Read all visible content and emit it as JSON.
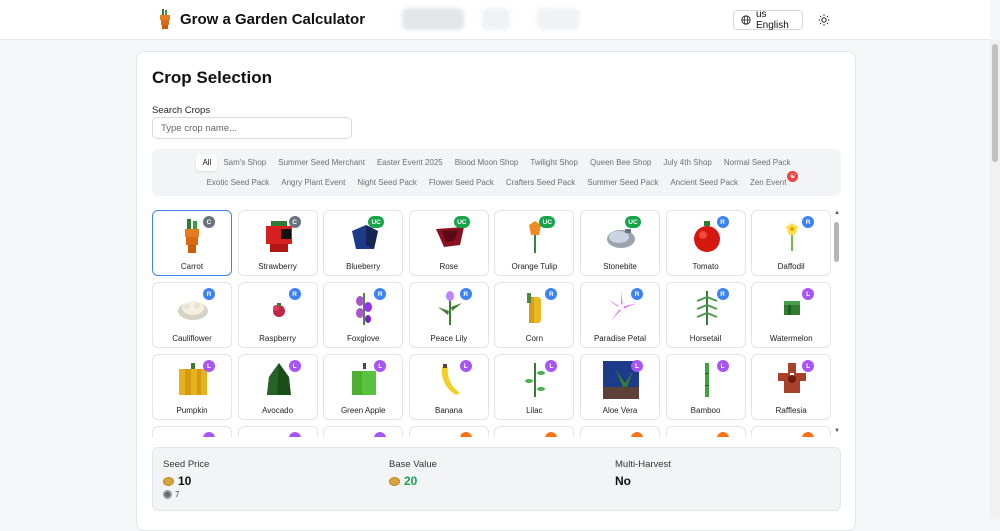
{
  "header": {
    "app_title": "Grow a Garden Calculator",
    "language_label": "us English"
  },
  "crop_selection": {
    "title": "Crop Selection",
    "search_label": "Search Crops",
    "search_placeholder": "Type crop name...",
    "filters_row1": [
      "All",
      "Sam's Shop",
      "Summer Seed Merchant",
      "Easter Event 2025",
      "Blood Moon Shop",
      "Twilight Shop",
      "Queen Bee Shop",
      "July 4th Shop",
      "Normal Seed Pack"
    ],
    "filters_row2": [
      "Exotic Seed Pack",
      "Angry Plant Event",
      "Night Seed Pack",
      "Flower Seed Pack",
      "Crafters Seed Pack",
      "Summer Seed Pack",
      "Ancient Seed Pack",
      "Zen Event"
    ],
    "active_filter": "All",
    "crops": [
      {
        "name": "Carrot",
        "rarity": "C",
        "icon": "carrot-icon"
      },
      {
        "name": "Strawberry",
        "rarity": "C",
        "icon": "strawberry-icon"
      },
      {
        "name": "Blueberry",
        "rarity": "UC",
        "icon": "blueberry-icon"
      },
      {
        "name": "Rose",
        "rarity": "UC",
        "icon": "rose-icon"
      },
      {
        "name": "Orange Tulip",
        "rarity": "UC",
        "icon": "orange-tulip-icon"
      },
      {
        "name": "Stonebite",
        "rarity": "UC",
        "icon": "stonebite-icon"
      },
      {
        "name": "Tomato",
        "rarity": "R",
        "icon": "tomato-icon"
      },
      {
        "name": "Daffodil",
        "rarity": "R",
        "icon": "daffodil-icon"
      },
      {
        "name": "Cauliflower",
        "rarity": "R",
        "icon": "cauliflower-icon"
      },
      {
        "name": "Raspberry",
        "rarity": "R",
        "icon": "raspberry-icon"
      },
      {
        "name": "Foxglove",
        "rarity": "R",
        "icon": "foxglove-icon"
      },
      {
        "name": "Peace Lily",
        "rarity": "R",
        "icon": "peace-lily-icon"
      },
      {
        "name": "Corn",
        "rarity": "R",
        "icon": "corn-icon"
      },
      {
        "name": "Paradise Petal",
        "rarity": "R",
        "icon": "paradise-petal-icon"
      },
      {
        "name": "Horsetail",
        "rarity": "R",
        "icon": "horsetail-icon"
      },
      {
        "name": "Watermelon",
        "rarity": "L",
        "icon": "watermelon-icon"
      },
      {
        "name": "Pumpkin",
        "rarity": "L",
        "icon": "pumpkin-icon"
      },
      {
        "name": "Avocado",
        "rarity": "L",
        "icon": "avocado-icon"
      },
      {
        "name": "Green Apple",
        "rarity": "L",
        "icon": "green-apple-icon"
      },
      {
        "name": "Banana",
        "rarity": "L",
        "icon": "banana-icon"
      },
      {
        "name": "Lilac",
        "rarity": "L",
        "icon": "lilac-icon"
      },
      {
        "name": "Aloe Vera",
        "rarity": "L",
        "icon": "aloe-vera-icon"
      },
      {
        "name": "Bamboo",
        "rarity": "L",
        "icon": "bamboo-icon"
      },
      {
        "name": "Rafflesia",
        "rarity": "L",
        "icon": "rafflesia-icon"
      }
    ],
    "next_row_rarities": [
      "L",
      "L",
      "L",
      "M",
      "M",
      "M",
      "M",
      "M"
    ],
    "selected_crop": "Carrot"
  },
  "stats": {
    "seed_price_label": "Seed Price",
    "seed_price_value": "10",
    "seed_price_alt_value": "7",
    "base_value_label": "Base Value",
    "base_value_value": "20",
    "multi_harvest_label": "Multi-Harvest",
    "multi_harvest_value": "No"
  },
  "colors": {
    "accent": "#3b82f6",
    "common": "#6b7280",
    "uncommon": "#16a34a",
    "rare": "#3b82f6",
    "legendary": "#a855f7",
    "mythical": "#f97316"
  }
}
